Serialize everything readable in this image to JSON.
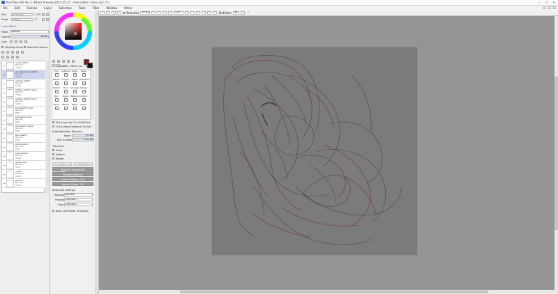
{
  "window": {
    "title": "PaintTool SAI Ver.2 (64bit) Preview.2022.05.27 - [Hana Neri / Ineri.sai2 (*)]",
    "controls": [
      "–",
      "□",
      "✕"
    ]
  },
  "menu": [
    "File",
    "Edit",
    "Canvas",
    "Layer",
    "Selection",
    "Tools",
    "Filter",
    "Window",
    "Other"
  ],
  "brush_panel": {
    "size_label": "Size",
    "size_value": "1.00",
    "angle_label": "Angle",
    "angle_value": "0°"
  },
  "layer_effect": {
    "header": "Layer Effect",
    "mode_label": "Mode",
    "mode_value": "Normal",
    "opacity_label": "Opacity",
    "opacity_value": "100%",
    "opacity_fraction": 1.0,
    "lock_label": "Lock",
    "clipping_label": "Clipping Group",
    "selection_source_label": "Selection Source"
  },
  "layers": [
    {
      "name": "cross sketch",
      "mode": "Normal",
      "opacity": "100%",
      "selected": false
    },
    {
      "name": "go experience sketch",
      "mode": "Normal",
      "opacity": "100%",
      "selected": true
    },
    {
      "name": "coming sketch",
      "mode": "Normal",
      "opacity": "100%",
      "selected": false
    },
    {
      "name": "clothes sketch upper",
      "mode": "Normal",
      "opacity": "100%",
      "selected": false
    },
    {
      "name": "clothes sketch lower",
      "mode": "Normal",
      "opacity": "100%",
      "selected": false
    },
    {
      "name": "hair sketch lower",
      "mode": "Normal",
      "opacity": "85%",
      "selected": false
    },
    {
      "name": "hair sketch new",
      "mode": "Normal",
      "opacity": "85%",
      "selected": false
    },
    {
      "name": "hair sketch upper",
      "mode": "Normal",
      "opacity": "85%",
      "selected": false
    },
    {
      "name": "face sketch",
      "mode": "Normal",
      "opacity": "85%",
      "selected": false
    },
    {
      "name": "hand sketch",
      "mode": "Normal",
      "opacity": "85%",
      "selected": false
    },
    {
      "name": "head sketch",
      "mode": "Normal",
      "opacity": "100%",
      "selected": false
    },
    {
      "name": "guide lines",
      "mode": "Normal",
      "opacity": "50%",
      "selected": false
    },
    {
      "name": "rough",
      "mode": "Normal",
      "opacity": "100%",
      "selected": false
    },
    {
      "name": "ground",
      "mode": "Normal",
      "opacity": "100%",
      "selected": false
    }
  ],
  "tool_tabs": [
    "Shapes",
    "Water",
    "Others",
    "Ve...",
    "Artistic"
  ],
  "tools": [
    {
      "name": "Pen"
    },
    {
      "name": "AirBrush"
    },
    {
      "name": "Brush"
    },
    {
      "name": "Water"
    },
    {
      "name": "Marker"
    },
    {
      "name": "Crayon"
    },
    {
      "name": "Water"
    },
    {
      "name": "Gradation"
    },
    {
      "name": "Binder"
    },
    {
      "name": "Blur"
    },
    {
      "name": "Smudge"
    },
    {
      "name": "Dodge"
    },
    {
      "name": "Blur"
    },
    {
      "name": "Spray"
    },
    {
      "name": "Watercol"
    },
    {
      "name": "Cutout"
    },
    {
      "name": "Pencil"
    },
    {
      "name": "Marker"
    },
    {
      "name": "Blend"
    },
    {
      "name": "Sketch"
    }
  ],
  "transform_options": {
    "pick_layer": "Pick Layer by Ctrl+Left/Click",
    "cut_move": "Cut & Move (without Ctrl Alt)",
    "drag_threshold_label": "Drag Detection Distance",
    "move_label": "Move",
    "move_value": "10 px",
    "pick_move_label": "Pick & Move",
    "pick_move_value": "1.00 px",
    "transform_label": "Transform",
    "scale_label": "Scale",
    "deform_label": "Deform",
    "rotate_label": "Rotate",
    "ok_label": "OK",
    "cancel_label": "Cancel",
    "perspective_label": "Perspective",
    "perspective_value": "0",
    "reverse_horizontal": "Reverse Horizontal",
    "reverse_vertical": "Reverse Vertical",
    "rotate_90_ccw": "Rotate 90deg. CCW",
    "rotate_90_cw": "Rotate 90deg. CW",
    "resample_label": "Resample Settings",
    "dragging_label": "Dragging",
    "dragging_value": "Bilinear",
    "preview_label": "Preview",
    "preview_value": "Lanczos 3",
    "final_label": "Final",
    "final_value": "Lanczos 3",
    "keep_line_width": "Keep Line Width of Shapes"
  },
  "toolbar": {
    "selection_label": "Selection",
    "zoom_value": "37.5%",
    "angle_value": "0.0°",
    "stabilizer_label": "Stabilizer",
    "stabilizer_value": "S3"
  },
  "colors": {
    "primary": "#7a1f1f",
    "secondary": "#111111",
    "accent_selected_layer": "#cdd6ef"
  }
}
